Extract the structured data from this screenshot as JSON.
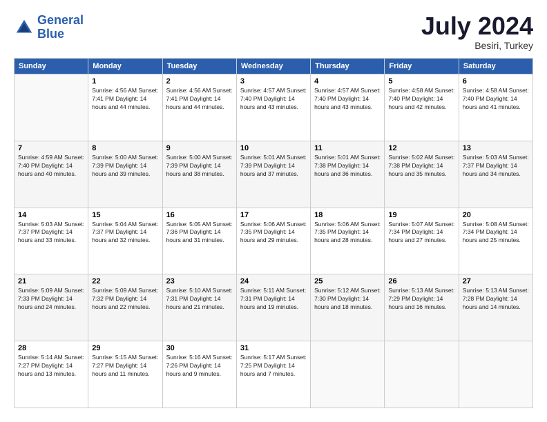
{
  "logo": {
    "line1": "General",
    "line2": "Blue"
  },
  "title": "July 2024",
  "location": "Besiri, Turkey",
  "days_of_week": [
    "Sunday",
    "Monday",
    "Tuesday",
    "Wednesday",
    "Thursday",
    "Friday",
    "Saturday"
  ],
  "weeks": [
    [
      {
        "day": "",
        "info": ""
      },
      {
        "day": "1",
        "info": "Sunrise: 4:56 AM\nSunset: 7:41 PM\nDaylight: 14 hours\nand 44 minutes."
      },
      {
        "day": "2",
        "info": "Sunrise: 4:56 AM\nSunset: 7:41 PM\nDaylight: 14 hours\nand 44 minutes."
      },
      {
        "day": "3",
        "info": "Sunrise: 4:57 AM\nSunset: 7:40 PM\nDaylight: 14 hours\nand 43 minutes."
      },
      {
        "day": "4",
        "info": "Sunrise: 4:57 AM\nSunset: 7:40 PM\nDaylight: 14 hours\nand 43 minutes."
      },
      {
        "day": "5",
        "info": "Sunrise: 4:58 AM\nSunset: 7:40 PM\nDaylight: 14 hours\nand 42 minutes."
      },
      {
        "day": "6",
        "info": "Sunrise: 4:58 AM\nSunset: 7:40 PM\nDaylight: 14 hours\nand 41 minutes."
      }
    ],
    [
      {
        "day": "7",
        "info": "Sunrise: 4:59 AM\nSunset: 7:40 PM\nDaylight: 14 hours\nand 40 minutes."
      },
      {
        "day": "8",
        "info": "Sunrise: 5:00 AM\nSunset: 7:39 PM\nDaylight: 14 hours\nand 39 minutes."
      },
      {
        "day": "9",
        "info": "Sunrise: 5:00 AM\nSunset: 7:39 PM\nDaylight: 14 hours\nand 38 minutes."
      },
      {
        "day": "10",
        "info": "Sunrise: 5:01 AM\nSunset: 7:39 PM\nDaylight: 14 hours\nand 37 minutes."
      },
      {
        "day": "11",
        "info": "Sunrise: 5:01 AM\nSunset: 7:38 PM\nDaylight: 14 hours\nand 36 minutes."
      },
      {
        "day": "12",
        "info": "Sunrise: 5:02 AM\nSunset: 7:38 PM\nDaylight: 14 hours\nand 35 minutes."
      },
      {
        "day": "13",
        "info": "Sunrise: 5:03 AM\nSunset: 7:37 PM\nDaylight: 14 hours\nand 34 minutes."
      }
    ],
    [
      {
        "day": "14",
        "info": "Sunrise: 5:03 AM\nSunset: 7:37 PM\nDaylight: 14 hours\nand 33 minutes."
      },
      {
        "day": "15",
        "info": "Sunrise: 5:04 AM\nSunset: 7:37 PM\nDaylight: 14 hours\nand 32 minutes."
      },
      {
        "day": "16",
        "info": "Sunrise: 5:05 AM\nSunset: 7:36 PM\nDaylight: 14 hours\nand 31 minutes."
      },
      {
        "day": "17",
        "info": "Sunrise: 5:06 AM\nSunset: 7:35 PM\nDaylight: 14 hours\nand 29 minutes."
      },
      {
        "day": "18",
        "info": "Sunrise: 5:06 AM\nSunset: 7:35 PM\nDaylight: 14 hours\nand 28 minutes."
      },
      {
        "day": "19",
        "info": "Sunrise: 5:07 AM\nSunset: 7:34 PM\nDaylight: 14 hours\nand 27 minutes."
      },
      {
        "day": "20",
        "info": "Sunrise: 5:08 AM\nSunset: 7:34 PM\nDaylight: 14 hours\nand 25 minutes."
      }
    ],
    [
      {
        "day": "21",
        "info": "Sunrise: 5:09 AM\nSunset: 7:33 PM\nDaylight: 14 hours\nand 24 minutes."
      },
      {
        "day": "22",
        "info": "Sunrise: 5:09 AM\nSunset: 7:32 PM\nDaylight: 14 hours\nand 22 minutes."
      },
      {
        "day": "23",
        "info": "Sunrise: 5:10 AM\nSunset: 7:31 PM\nDaylight: 14 hours\nand 21 minutes."
      },
      {
        "day": "24",
        "info": "Sunrise: 5:11 AM\nSunset: 7:31 PM\nDaylight: 14 hours\nand 19 minutes."
      },
      {
        "day": "25",
        "info": "Sunrise: 5:12 AM\nSunset: 7:30 PM\nDaylight: 14 hours\nand 18 minutes."
      },
      {
        "day": "26",
        "info": "Sunrise: 5:13 AM\nSunset: 7:29 PM\nDaylight: 14 hours\nand 16 minutes."
      },
      {
        "day": "27",
        "info": "Sunrise: 5:13 AM\nSunset: 7:28 PM\nDaylight: 14 hours\nand 14 minutes."
      }
    ],
    [
      {
        "day": "28",
        "info": "Sunrise: 5:14 AM\nSunset: 7:27 PM\nDaylight: 14 hours\nand 13 minutes."
      },
      {
        "day": "29",
        "info": "Sunrise: 5:15 AM\nSunset: 7:27 PM\nDaylight: 14 hours\nand 11 minutes."
      },
      {
        "day": "30",
        "info": "Sunrise: 5:16 AM\nSunset: 7:26 PM\nDaylight: 14 hours\nand 9 minutes."
      },
      {
        "day": "31",
        "info": "Sunrise: 5:17 AM\nSunset: 7:25 PM\nDaylight: 14 hours\nand 7 minutes."
      },
      {
        "day": "",
        "info": ""
      },
      {
        "day": "",
        "info": ""
      },
      {
        "day": "",
        "info": ""
      }
    ]
  ]
}
